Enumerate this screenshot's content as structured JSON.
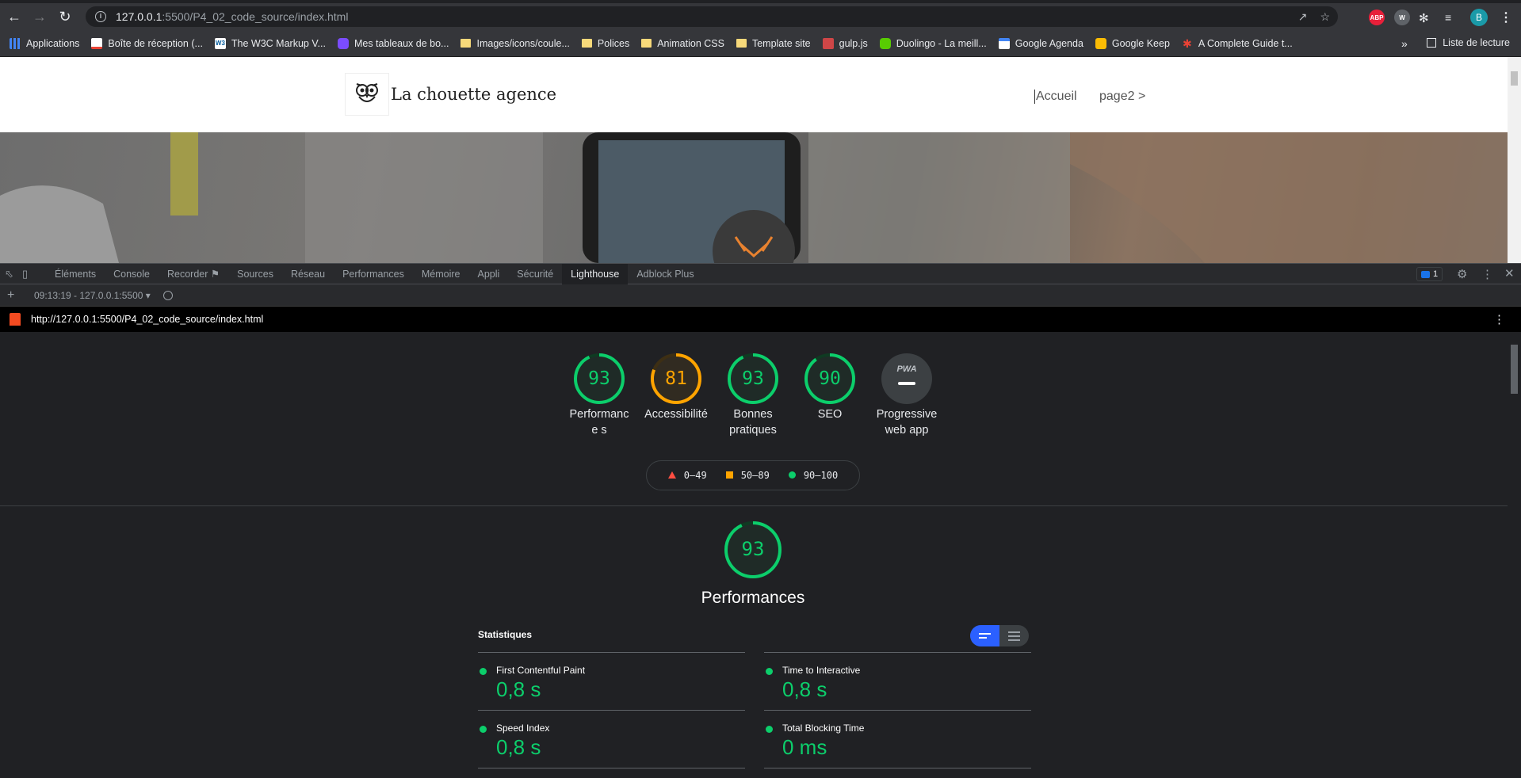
{
  "browser": {
    "url_host": "127.0.0.1",
    "url_path": ":5500/P4_02_code_source/index.html",
    "profile_initial": "B",
    "extensions": [
      "ABP",
      "W"
    ]
  },
  "bookmarks": {
    "items": [
      {
        "label": "Applications",
        "icon": "apps-grid-icon"
      },
      {
        "label": "Boîte de réception (...",
        "icon": "gmail-icon"
      },
      {
        "label": "The W3C Markup V...",
        "icon": "w3c-icon"
      },
      {
        "label": "Mes tableaux de bo...",
        "icon": "app-icon"
      },
      {
        "label": "Images/icons/coule...",
        "icon": "folder-icon"
      },
      {
        "label": "Polices",
        "icon": "folder-icon"
      },
      {
        "label": "Animation CSS",
        "icon": "folder-icon"
      },
      {
        "label": "Template site",
        "icon": "folder-icon"
      },
      {
        "label": "gulp.js",
        "icon": "gulp-icon"
      },
      {
        "label": "Duolingo - La meill...",
        "icon": "duolingo-icon"
      },
      {
        "label": "Google Agenda",
        "icon": "calendar-icon"
      },
      {
        "label": "Google Keep",
        "icon": "keep-icon"
      },
      {
        "label": "A Complete Guide t...",
        "icon": "star-icon"
      }
    ],
    "more": "»",
    "reading_list": "Liste de lecture"
  },
  "site": {
    "logo_text": "La chouette agence",
    "nav": [
      "Accueil",
      "page2 >"
    ]
  },
  "devtools": {
    "tabs": [
      "Éléments",
      "Console",
      "Recorder",
      "Sources",
      "Réseau",
      "Performances",
      "Mémoire",
      "Appli",
      "Sécurité",
      "Lighthouse",
      "Adblock Plus"
    ],
    "active_tab": "Lighthouse",
    "issues_count": "1",
    "report_selector": "09:13:19 - 127.0.0.1:5500"
  },
  "lighthouse": {
    "url": "http://127.0.0.1:5500/P4_02_code_source/index.html",
    "scores": [
      {
        "value": "93",
        "label": "Performance s",
        "level": "pass"
      },
      {
        "value": "81",
        "label": "Accessibilité",
        "level": "average"
      },
      {
        "value": "93",
        "label": "Bonnes pratiques",
        "level": "pass"
      },
      {
        "value": "90",
        "label": "SEO",
        "level": "pass"
      },
      {
        "value": "PWA",
        "label": "Progressive web app",
        "level": "pwa"
      }
    ],
    "legend": [
      "0–49",
      "50–89",
      "90–100"
    ],
    "main_score": "93",
    "main_title": "Performances",
    "stats_title": "Statistiques",
    "metrics": [
      {
        "name": "First Contentful Paint",
        "value": "0,8 s"
      },
      {
        "name": "Time to Interactive",
        "value": "0,8 s"
      },
      {
        "name": "Speed Index",
        "value": "0,8 s"
      },
      {
        "name": "Total Blocking Time",
        "value": "0 ms"
      }
    ]
  },
  "colors": {
    "pass": "#0cce6b",
    "average": "#ffa400",
    "fail": "#ff4e42",
    "toggle_active": "#2b60ff"
  }
}
